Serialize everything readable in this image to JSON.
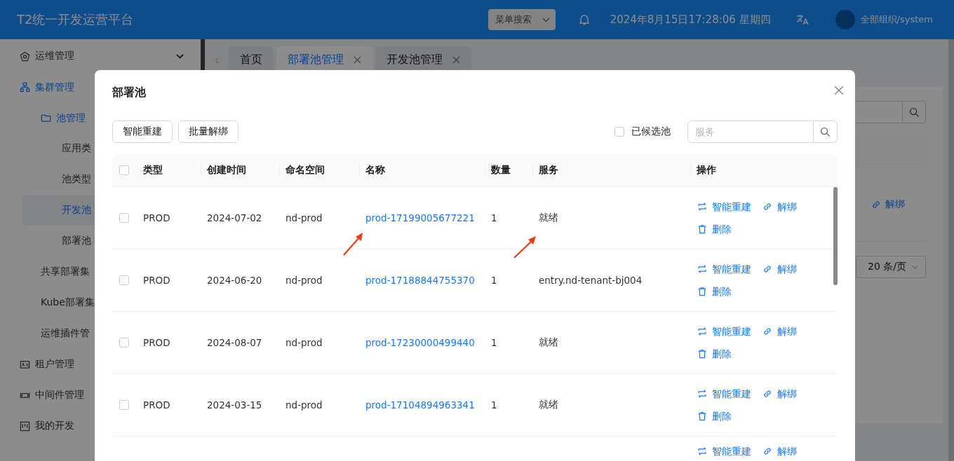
{
  "header": {
    "title": "T2统一开发运营平台",
    "menu_search": {
      "placeholder": "菜单搜索"
    },
    "datetime": "2024年8月15日17:28:06 星期四",
    "user": "全部组织/system"
  },
  "sidebar": {
    "items": [
      {
        "label": "运维管理",
        "expanded": false,
        "selected": false
      },
      {
        "label": "集群管理",
        "expanded": true,
        "selected": false,
        "children": [
          {
            "label": "池管理",
            "expanded": true,
            "selected": false,
            "children": [
              {
                "label": "应用类",
                "selected": false
              },
              {
                "label": "池类型",
                "selected": false
              },
              {
                "label": "开发池",
                "selected": true
              },
              {
                "label": "部署池",
                "selected": false
              }
            ]
          },
          {
            "label": "共享部署集",
            "selected": false
          },
          {
            "label": "Kube部署集",
            "selected": false
          },
          {
            "label": "运维插件管",
            "selected": false
          }
        ]
      },
      {
        "label": "租户管理",
        "selected": false
      },
      {
        "label": "中间件管理",
        "selected": false
      },
      {
        "label": "我的开发",
        "selected": false
      }
    ]
  },
  "tabs": [
    {
      "label": "首页",
      "selected": false,
      "closable": false
    },
    {
      "label": "部署池管理",
      "selected": true,
      "closable": true
    },
    {
      "label": "开发池管理",
      "selected": false,
      "closable": true
    }
  ],
  "page": {
    "row_action": "解绑",
    "page_size": "20 条/页"
  },
  "dialog": {
    "title": "部署池",
    "buttons": [
      "智能重建",
      "批量解绑"
    ],
    "filter": {
      "label": "已候选池",
      "checked": false
    },
    "search": {
      "placeholder": "服务"
    },
    "table": {
      "all_selected": false,
      "columns": [
        {
          "label": "类型",
          "kind": "text"
        },
        {
          "label": "创建时间",
          "kind": "text"
        },
        {
          "label": "命名空间",
          "kind": "text"
        },
        {
          "label": "名称",
          "kind": "link"
        },
        {
          "label": "数量",
          "kind": "text"
        },
        {
          "label": "服务",
          "kind": "text"
        },
        {
          "label": "操作",
          "kind": "actions"
        }
      ],
      "rows": [
        {
          "selected": false,
          "cells": [
            "PROD",
            "2024-07-02",
            "nd-prod",
            "prod-17199005677221",
            "1",
            "就绪"
          ],
          "actions": [
            {
              "kind": "rebuild",
              "label": "智能重建"
            },
            {
              "kind": "unbind",
              "label": "解绑"
            },
            {
              "kind": "delete",
              "label": "删除"
            }
          ]
        },
        {
          "selected": false,
          "cells": [
            "PROD",
            "2024-06-20",
            "nd-prod",
            "prod-17188844755370",
            "1",
            "entry.nd-tenant-bj004"
          ],
          "actions": [
            {
              "kind": "rebuild",
              "label": "智能重建"
            },
            {
              "kind": "unbind",
              "label": "解绑"
            },
            {
              "kind": "delete",
              "label": "删除"
            }
          ]
        },
        {
          "selected": false,
          "cells": [
            "PROD",
            "2024-08-07",
            "nd-prod",
            "prod-17230000499440",
            "1",
            "就绪"
          ],
          "actions": [
            {
              "kind": "rebuild",
              "label": "智能重建"
            },
            {
              "kind": "unbind",
              "label": "解绑"
            },
            {
              "kind": "delete",
              "label": "删除"
            }
          ]
        },
        {
          "selected": false,
          "cells": [
            "PROD",
            "2024-03-15",
            "nd-prod",
            "prod-17104894963341",
            "1",
            "就绪"
          ],
          "actions": [
            {
              "kind": "rebuild",
              "label": "智能重建"
            },
            {
              "kind": "unbind",
              "label": "解绑"
            },
            {
              "kind": "delete",
              "label": "删除"
            }
          ]
        },
        {
          "actions": [
            {
              "kind": "rebuild",
              "label": "智能重建"
            },
            {
              "kind": "unbind",
              "label": "解绑"
            }
          ]
        }
      ]
    }
  }
}
